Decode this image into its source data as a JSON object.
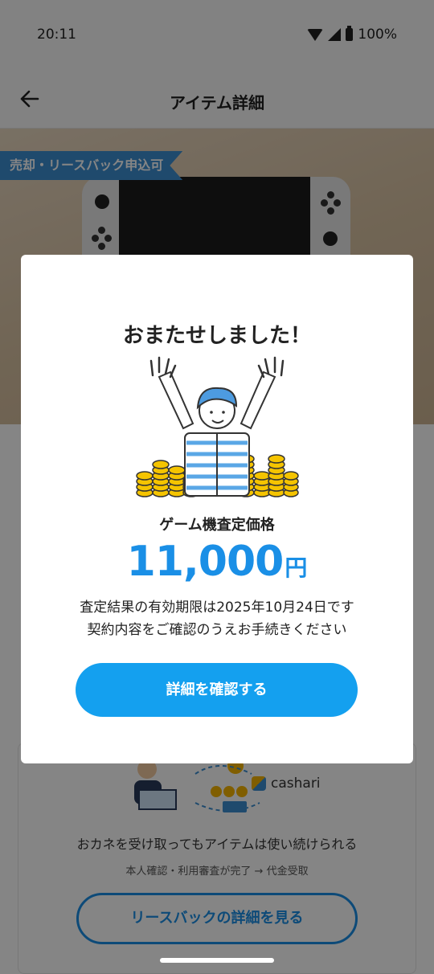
{
  "status_bar": {
    "time": "20:11",
    "battery": "100%"
  },
  "app_bar": {
    "title": "アイテム詳細",
    "back_icon": "arrow-left-icon"
  },
  "hero": {
    "badge": "売却・リースバック申込可"
  },
  "background_card": {
    "brand": "cashari",
    "headline": "おカネを受け取ってもアイテムは使い続けられる",
    "subtext": "本人確認・利用審査が完了 → 代金受取",
    "button_label": "リースバックの詳細を見る"
  },
  "modal": {
    "title": "おまたせしました！",
    "price_label": "ゲーム機査定価格",
    "price_value": "11,000",
    "price_unit": "円",
    "info_line1": "査定結果の有効期限は2025年10月24日です",
    "info_line2": "契約内容をご確認のうえお手続きください",
    "button_label": "詳細を確認する"
  },
  "colors": {
    "accent": "#1a8fe6",
    "primary_button": "#14a0ef",
    "badge": "#3d8fd1"
  }
}
